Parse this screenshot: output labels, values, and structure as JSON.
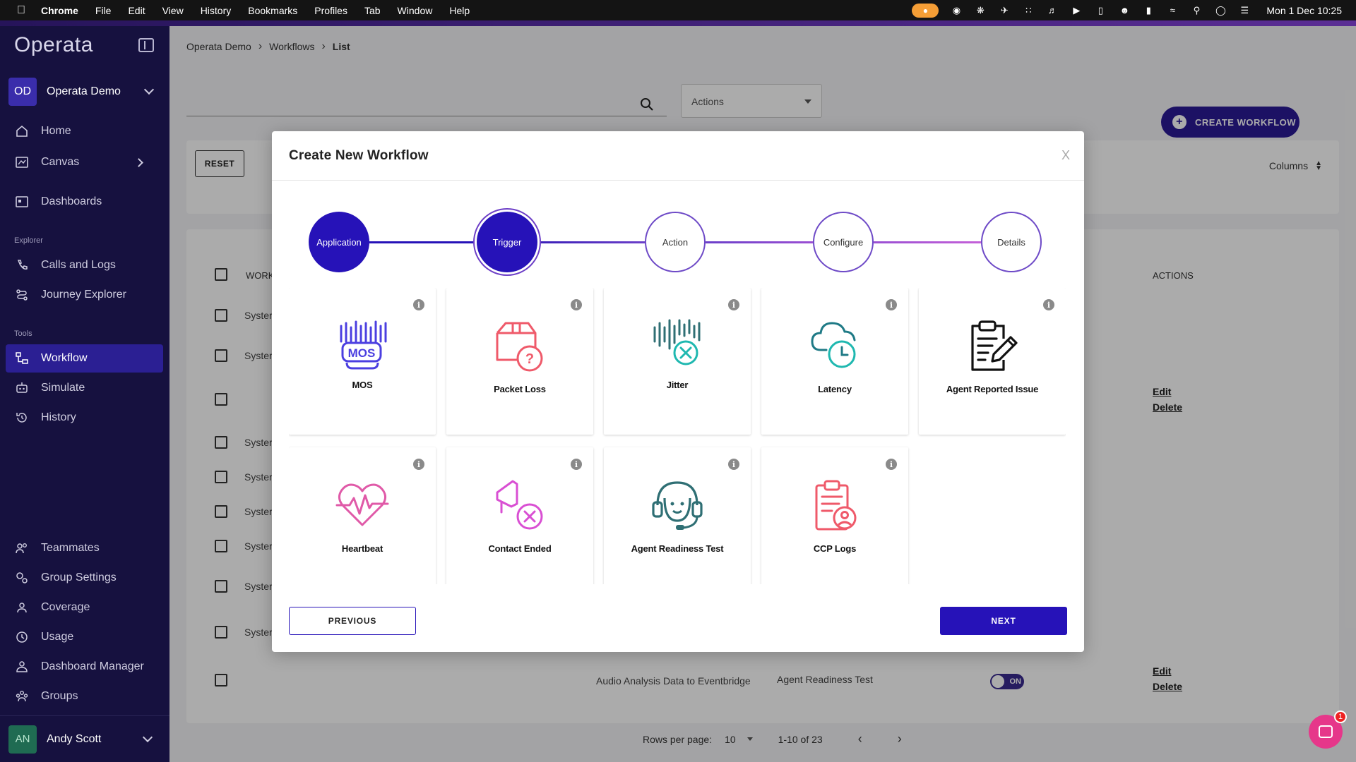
{
  "menubar": {
    "app": "Chrome",
    "items": [
      "File",
      "Edit",
      "View",
      "History",
      "Bookmarks",
      "Profiles",
      "Tab",
      "Window",
      "Help"
    ],
    "clock": "Mon 1 Dec  10:25"
  },
  "sidebar": {
    "logo": "Operata",
    "org": {
      "initials": "OD",
      "name": "Operata Demo"
    },
    "nav": [
      {
        "label": "Home",
        "icon": "home-icon"
      },
      {
        "label": "Canvas",
        "icon": "canvas-icon"
      },
      {
        "label": "Dashboards",
        "icon": "dashboards-icon"
      }
    ],
    "explorer_label": "Explorer",
    "explorer": [
      {
        "label": "Calls and Logs",
        "icon": "phone-icon"
      },
      {
        "label": "Journey Explorer",
        "icon": "journey-icon"
      }
    ],
    "tools_label": "Tools",
    "tools": [
      {
        "label": "Workflow",
        "icon": "workflow-icon"
      },
      {
        "label": "Simulate",
        "icon": "robot-icon"
      },
      {
        "label": "History",
        "icon": "history-icon"
      }
    ],
    "bottom": [
      {
        "label": "Teammates",
        "icon": "teammates-icon"
      },
      {
        "label": "Group Settings",
        "icon": "group-settings-icon"
      },
      {
        "label": "Coverage",
        "icon": "coverage-icon"
      },
      {
        "label": "Usage",
        "icon": "usage-icon"
      },
      {
        "label": "Dashboard Manager",
        "icon": "dashboard-manager-icon"
      },
      {
        "label": "Groups",
        "icon": "groups-icon"
      }
    ],
    "user": {
      "initials": "AN",
      "name": "Andy Scott"
    }
  },
  "breadcrumb": [
    "Operata Demo",
    "Workflows",
    "List"
  ],
  "toolbar": {
    "actions_label": "Actions",
    "create_label": "CREATE WORKFLOW",
    "reset_label": "RESET",
    "columns_label": "Columns"
  },
  "table": {
    "header_workflow": "WORK",
    "header_actions": "ACTIONS",
    "system_text": "Syster",
    "edit_label": "Edit",
    "delete_label": "Delete",
    "last_row_name": "Audio Analysis Data to Eventbridge",
    "last_row_trigger": "Agent Readiness Test",
    "toggle_label": "ON"
  },
  "pager": {
    "rows_label": "Rows per page:",
    "rows_value": "10",
    "count": "1-10 of 23"
  },
  "chat": {
    "badge": "1"
  },
  "modal": {
    "title": "Create New Workflow",
    "close": "X",
    "steps": [
      {
        "label": "Application",
        "state": "done"
      },
      {
        "label": "Trigger",
        "state": "current"
      },
      {
        "label": "Action",
        "state": "pending"
      },
      {
        "label": "Configure",
        "state": "pending"
      },
      {
        "label": "Details",
        "state": "pending"
      }
    ],
    "cards": [
      {
        "label": "MOS",
        "icon": "mos-icon"
      },
      {
        "label": "Packet Loss",
        "icon": "packet-loss-icon"
      },
      {
        "label": "Jitter",
        "icon": "jitter-icon"
      },
      {
        "label": "Latency",
        "icon": "latency-icon"
      },
      {
        "label": "Agent Reported Issue",
        "icon": "agent-reported-issue-icon"
      },
      {
        "label": "Heartbeat",
        "icon": "heartbeat-icon"
      },
      {
        "label": "Contact Ended",
        "icon": "contact-ended-icon"
      },
      {
        "label": "Agent Readiness Test",
        "icon": "agent-readiness-icon"
      },
      {
        "label": "CCP Logs",
        "icon": "ccp-logs-icon"
      }
    ],
    "info_glyph": "i",
    "prev_label": "PREVIOUS",
    "next_label": "NEXT"
  },
  "colors": {
    "primary": "#2612b8",
    "sidebar": "#16113f",
    "accent_pink": "#e6378a"
  }
}
